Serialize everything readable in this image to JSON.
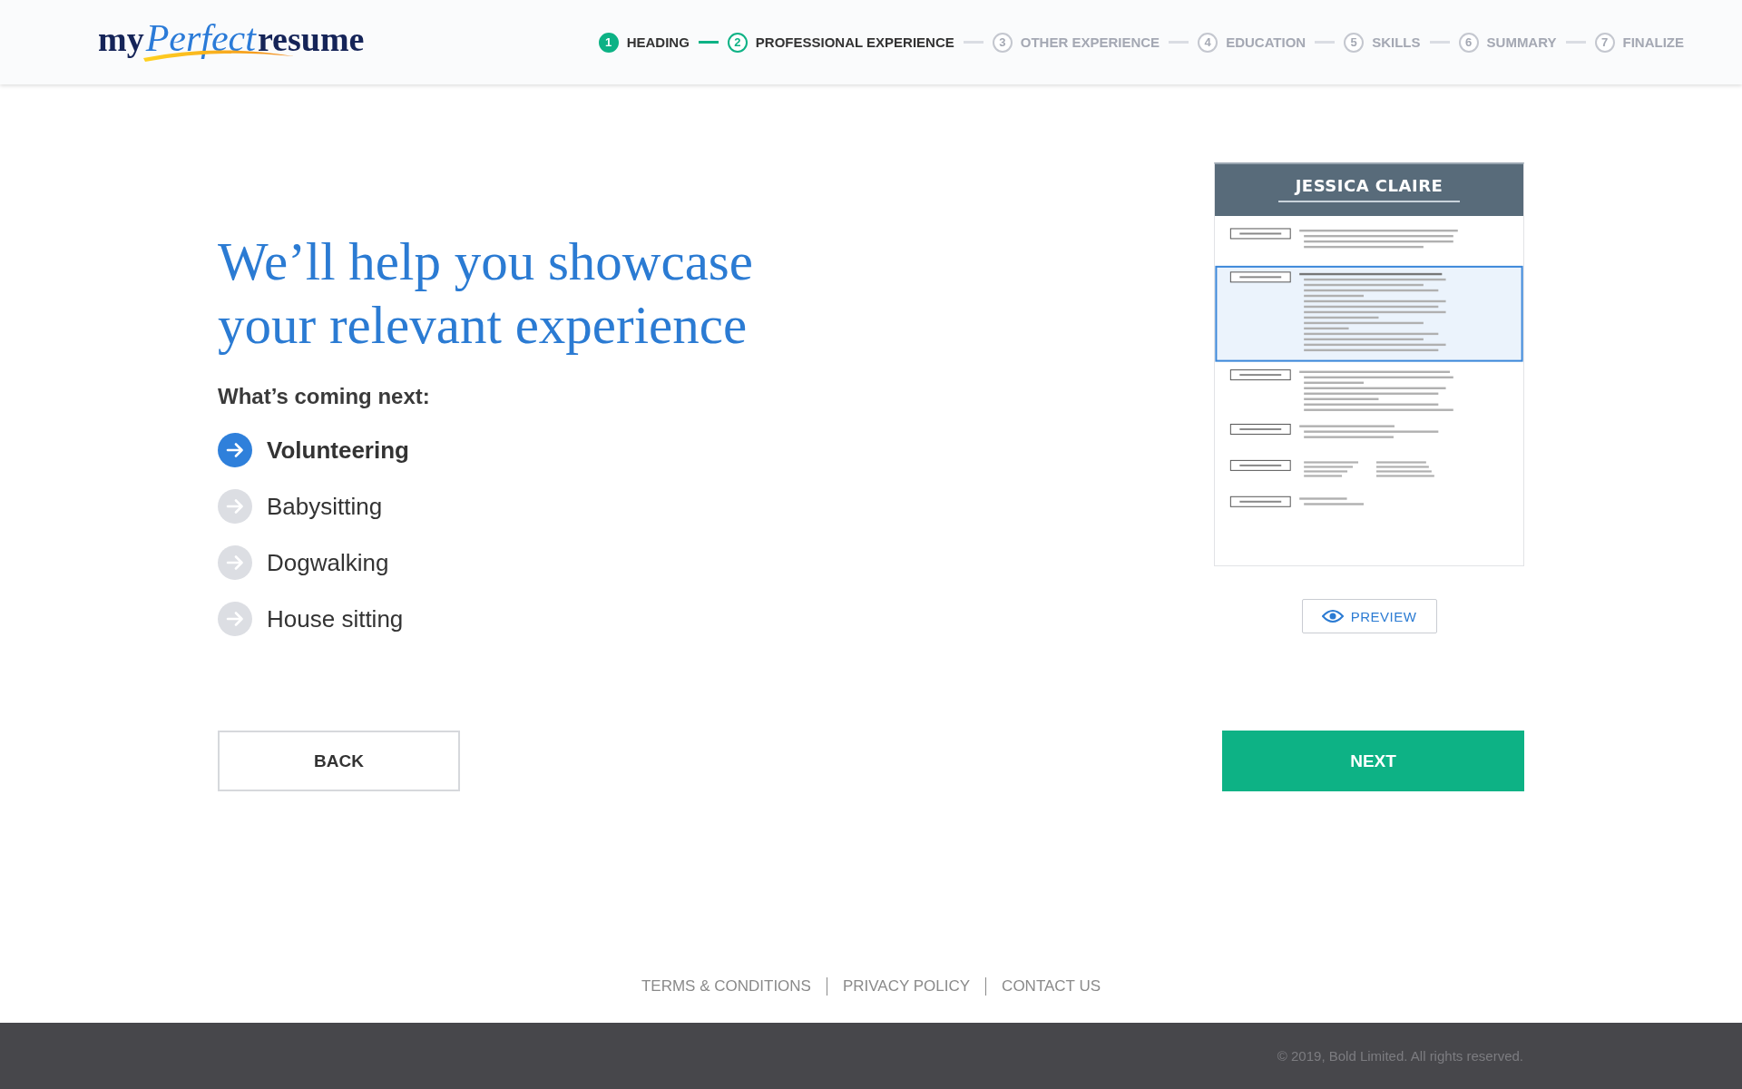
{
  "logo": {
    "parts": [
      "my",
      "Perfect",
      "resume"
    ]
  },
  "steps": [
    {
      "number": "1",
      "label": "HEADING",
      "done": true,
      "current": false
    },
    {
      "number": "2",
      "label": "PROFESSIONAL EXPERIENCE",
      "done": false,
      "current": true
    },
    {
      "number": "3",
      "label": "OTHER EXPERIENCE",
      "done": false,
      "current": false
    },
    {
      "number": "4",
      "label": "EDUCATION",
      "done": false,
      "current": false
    },
    {
      "number": "5",
      "label": "SKILLS",
      "done": false,
      "current": false
    },
    {
      "number": "6",
      "label": "SUMMARY",
      "done": false,
      "current": false
    },
    {
      "number": "7",
      "label": "FINALIZE",
      "done": false,
      "current": false
    }
  ],
  "headline": [
    "We’ll help you showcase",
    "your relevant experience"
  ],
  "next_title": "What’s coming next:",
  "next_items": [
    {
      "label": "Volunteering",
      "current": true
    },
    {
      "label": "Babysitting",
      "current": false
    },
    {
      "label": "Dogwalking",
      "current": false
    },
    {
      "label": "House sitting",
      "current": false
    }
  ],
  "resume": {
    "name": "JESSICA CLAIRE"
  },
  "preview_button": "PREVIEW",
  "back_button": "BACK",
  "next_button": "NEXT",
  "footer_links": [
    "TERMS & CONDITIONS",
    "PRIVACY POLICY",
    "CONTACT US"
  ],
  "copyright": "© 2019, Bold Limited. All rights reserved."
}
